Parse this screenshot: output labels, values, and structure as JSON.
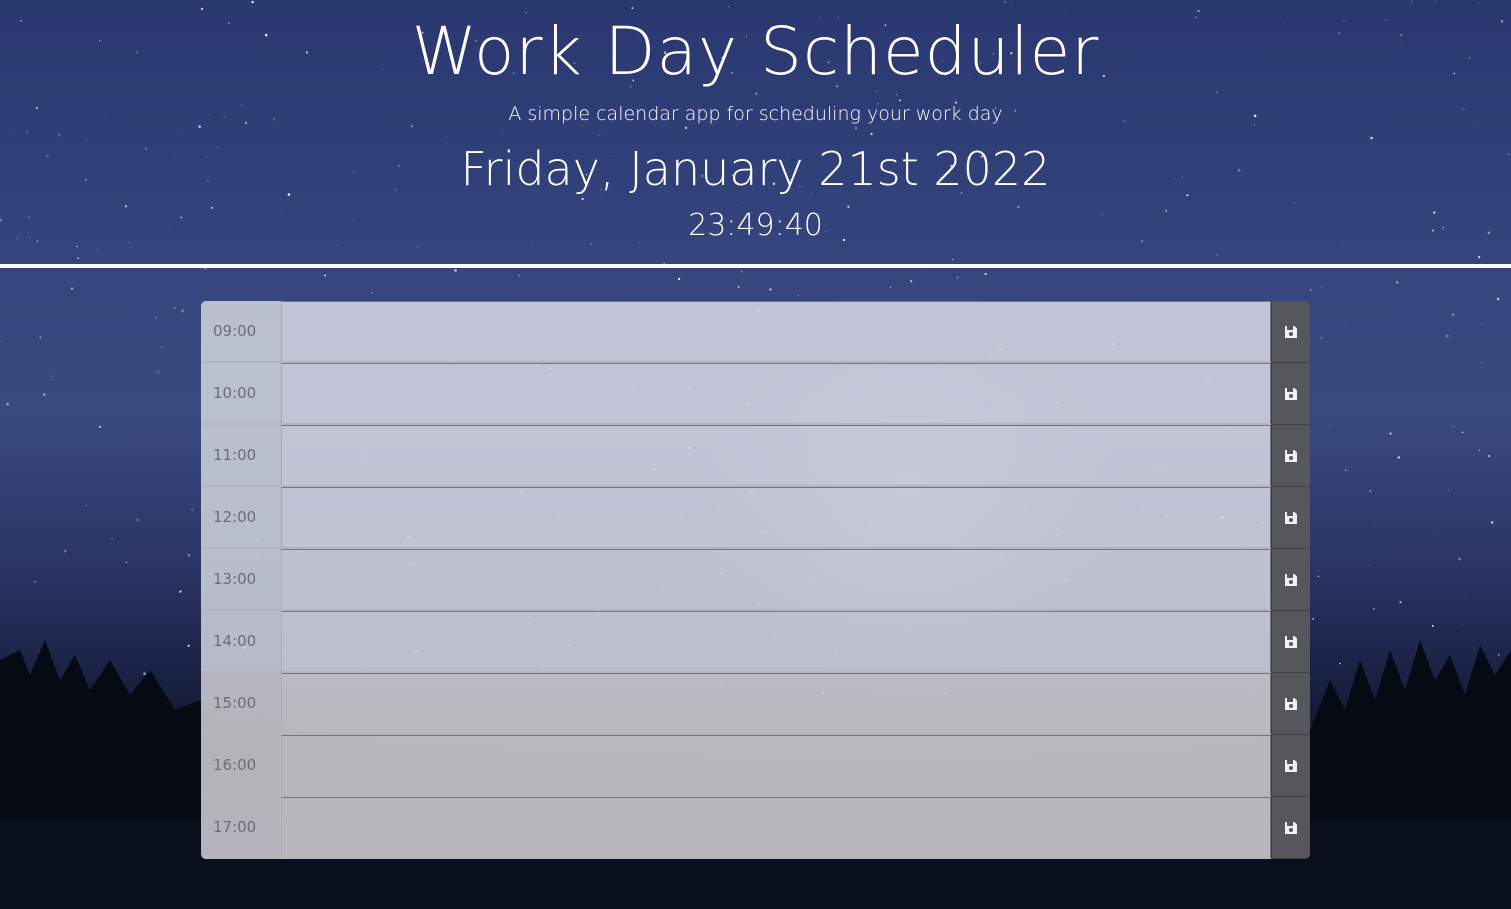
{
  "header": {
    "title": "Work Day Scheduler",
    "subtitle": "A simple calendar app for scheduling your work day",
    "current_date": "Friday, January 21st 2022",
    "current_time": "23:49:40"
  },
  "schedule": {
    "rows": [
      {
        "hour": "09:00",
        "text": "",
        "save_icon": "floppy-disk-icon"
      },
      {
        "hour": "10:00",
        "text": "",
        "save_icon": "floppy-disk-icon"
      },
      {
        "hour": "11:00",
        "text": "",
        "save_icon": "floppy-disk-icon"
      },
      {
        "hour": "12:00",
        "text": "",
        "save_icon": "floppy-disk-icon"
      },
      {
        "hour": "13:00",
        "text": "",
        "save_icon": "floppy-disk-icon"
      },
      {
        "hour": "14:00",
        "text": "",
        "save_icon": "floppy-disk-icon"
      },
      {
        "hour": "15:00",
        "text": "",
        "save_icon": "floppy-disk-icon"
      },
      {
        "hour": "16:00",
        "text": "",
        "save_icon": "floppy-disk-icon"
      },
      {
        "hour": "17:00",
        "text": "",
        "save_icon": "floppy-disk-icon"
      }
    ]
  },
  "colors": {
    "save_button": "#55575c",
    "hour_text": "#6b6e78",
    "divider": "#ffffff",
    "sky_top": "#2a3770",
    "sky_bottom": "#070b18"
  }
}
